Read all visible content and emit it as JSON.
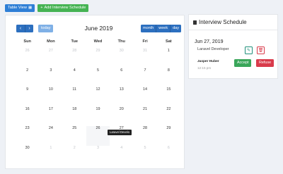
{
  "toolbar": {
    "table_view_label": "Table View",
    "table_view_icon": "grid-icon",
    "add_interview_label": "Add Interview Schedule",
    "add_interview_icon": "plus-icon"
  },
  "calendar": {
    "prev_icon": "chevron-left-icon",
    "next_icon": "chevron-right-icon",
    "today_label": "today",
    "title": "June 2019",
    "views": [
      "month",
      "week",
      "day"
    ],
    "weekdays": [
      "Sun",
      "Mon",
      "Tue",
      "Wed",
      "Thu",
      "Fri",
      "Sat"
    ],
    "weeks": [
      [
        {
          "d": "26",
          "o": true
        },
        {
          "d": "27",
          "o": true
        },
        {
          "d": "28",
          "o": true
        },
        {
          "d": "29",
          "o": true
        },
        {
          "d": "30",
          "o": true
        },
        {
          "d": "31",
          "o": true
        },
        {
          "d": "1",
          "o": false
        }
      ],
      [
        {
          "d": "2",
          "o": false
        },
        {
          "d": "3",
          "o": false
        },
        {
          "d": "4",
          "o": false
        },
        {
          "d": "5",
          "o": false
        },
        {
          "d": "6",
          "o": false
        },
        {
          "d": "7",
          "o": false
        },
        {
          "d": "8",
          "o": false
        }
      ],
      [
        {
          "d": "9",
          "o": false
        },
        {
          "d": "10",
          "o": false
        },
        {
          "d": "11",
          "o": false
        },
        {
          "d": "12",
          "o": false
        },
        {
          "d": "13",
          "o": false
        },
        {
          "d": "14",
          "o": false
        },
        {
          "d": "15",
          "o": false
        }
      ],
      [
        {
          "d": "16",
          "o": false
        },
        {
          "d": "17",
          "o": false
        },
        {
          "d": "18",
          "o": false
        },
        {
          "d": "19",
          "o": false
        },
        {
          "d": "20",
          "o": false
        },
        {
          "d": "21",
          "o": false
        },
        {
          "d": "22",
          "o": false
        }
      ],
      [
        {
          "d": "23",
          "o": false
        },
        {
          "d": "24",
          "o": false
        },
        {
          "d": "25",
          "o": false
        },
        {
          "d": "26",
          "o": false
        },
        {
          "d": "27",
          "o": false
        },
        {
          "d": "28",
          "o": false
        },
        {
          "d": "29",
          "o": false
        }
      ],
      [
        {
          "d": "30",
          "o": false
        },
        {
          "d": "1",
          "o": true
        },
        {
          "d": "2",
          "o": true
        },
        {
          "d": "3",
          "o": true
        },
        {
          "d": "4",
          "o": true
        },
        {
          "d": "5",
          "o": true
        },
        {
          "d": "6",
          "o": true
        }
      ]
    ],
    "event_tooltip": "Laravel Develo"
  },
  "schedule": {
    "title": "Interview Schedule",
    "title_icon": "document-icon",
    "date": "Jun 27, 2019",
    "role": "Laravel Developer",
    "candidate": "Jasper Huber",
    "time": "12:15 pm",
    "edit_icon": "pencil-icon",
    "delete_icon": "trash-icon",
    "accept_label": "Accept",
    "refuse_label": "Refuse"
  },
  "colors": {
    "primary": "#2c6fbf",
    "success": "#3aa65a",
    "danger": "#d93b4b"
  }
}
